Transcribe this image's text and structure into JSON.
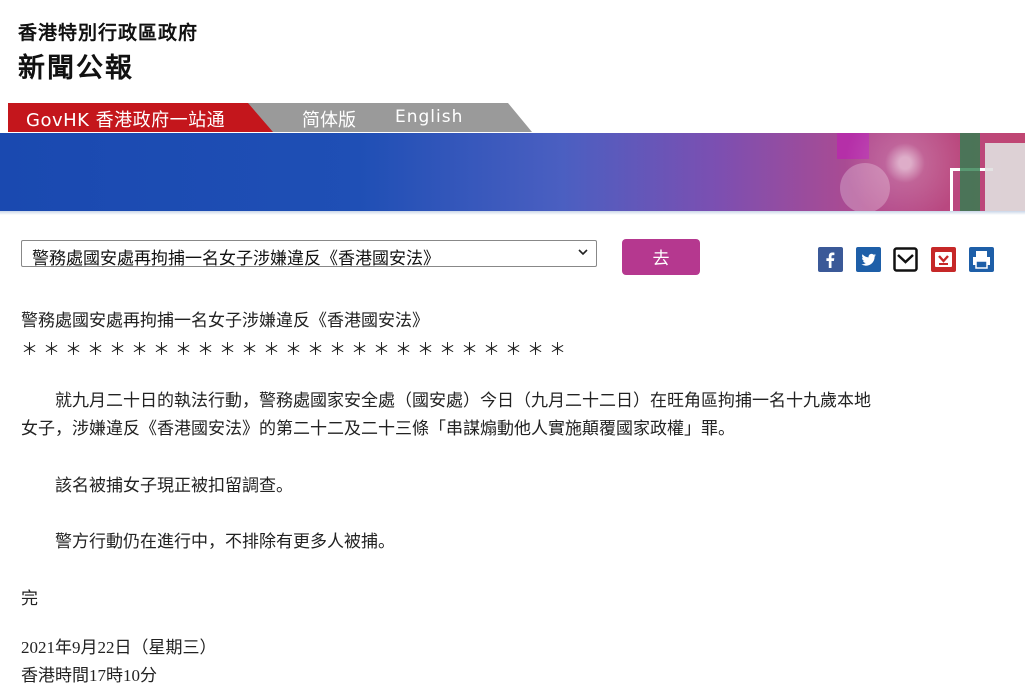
{
  "header": {
    "dept_name": "香港特別行政區政府",
    "bulletin_name": "新聞公報"
  },
  "nav": {
    "govhk_label": "GovHK 香港政府一站通",
    "simplified_label": "简体版",
    "english_label": "English"
  },
  "toolbar": {
    "article_select_value": "警務處國安處再拘捕一名女子涉嫌違反《香港國安法》",
    "go_label": "去",
    "share_icons": [
      "facebook-icon",
      "twitter-icon",
      "email-icon",
      "bookmark-icon",
      "print-icon"
    ]
  },
  "article": {
    "title": "警務處國安處再拘捕一名女子涉嫌違反《香港國安法》",
    "stars": "＊＊＊＊＊＊＊＊＊＊＊＊＊＊＊＊＊＊＊＊＊＊＊＊＊",
    "para1_line1": "　　就九月二十日的執法行動，警務處國家安全處（國安處）今日（九月二十二日）在旺角區拘捕一名十九歲本地",
    "para1_line2": "女子，涉嫌違反《香港國安法》的第二十二及二十三條「串謀煽動他人實施顛覆國家政權」罪。",
    "para2": "　　該名被捕女子現正被扣留調查。",
    "para3": "　　警方行動仍在進行中，不排除有更多人被捕。",
    "end_mark": "完",
    "date": "2021年9月22日（星期三）",
    "time": "香港時間17時10分"
  },
  "colors": {
    "nav_red": "#c4161c",
    "nav_grey": "#9a9a9a",
    "go_button": "#b5388f",
    "share_blue": "#1e5fa8"
  }
}
